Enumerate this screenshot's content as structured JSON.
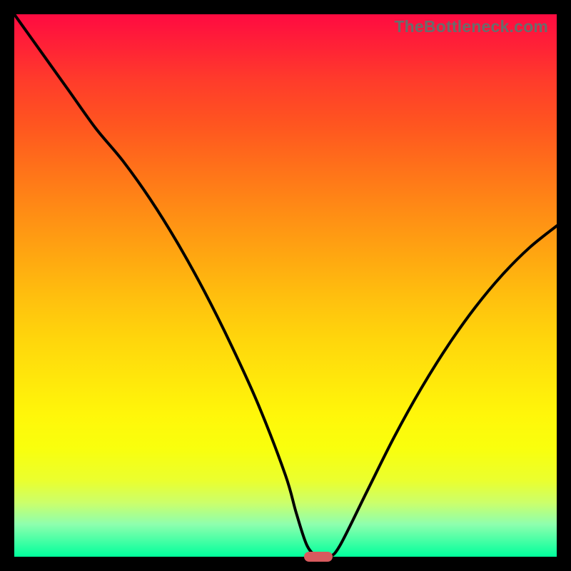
{
  "attribution": "TheBottleneck.com",
  "colors": {
    "background": "#000000",
    "curve": "#000000",
    "marker": "#d85a5e"
  },
  "chart_data": {
    "type": "line",
    "title": "",
    "xlabel": "",
    "ylabel": "",
    "xlim": [
      0,
      100
    ],
    "ylim": [
      0,
      100
    ],
    "curve": {
      "x": [
        0,
        5,
        10,
        15,
        20,
        25,
        30,
        35,
        40,
        45,
        50,
        52,
        54,
        56,
        58,
        60,
        65,
        70,
        75,
        80,
        85,
        90,
        95,
        100
      ],
      "y": [
        100,
        93,
        86,
        79,
        73,
        66,
        58,
        49,
        39,
        28,
        15,
        8,
        2,
        0,
        0,
        2,
        12,
        22,
        31,
        39,
        46,
        52,
        57,
        61
      ]
    },
    "optimum_marker": {
      "x": 56,
      "y": 0
    },
    "gradient_stops": [
      {
        "pct": 0,
        "color": "#ff0b41"
      },
      {
        "pct": 20,
        "color": "#ff5420"
      },
      {
        "pct": 40,
        "color": "#ff9a13"
      },
      {
        "pct": 60,
        "color": "#ffd60c"
      },
      {
        "pct": 80,
        "color": "#f9ff0d"
      },
      {
        "pct": 100,
        "color": "#00ff9c"
      }
    ]
  }
}
